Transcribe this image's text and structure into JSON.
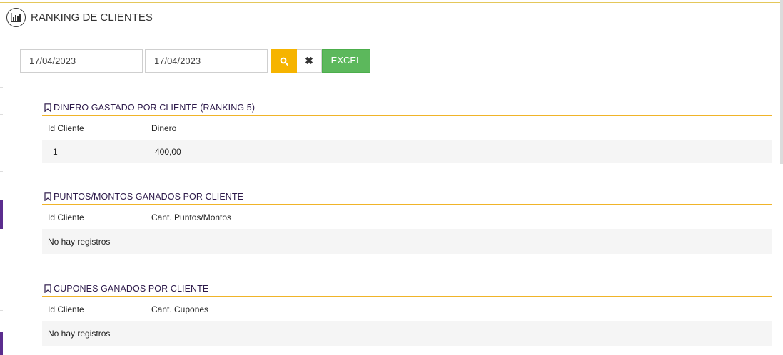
{
  "page": {
    "title": "RANKING DE CLIENTES",
    "header_icon": "bar-chart-icon"
  },
  "filters": {
    "date_from": "17/04/2023",
    "date_to": "17/04/2023",
    "search_icon": "search-icon",
    "clear_icon": "close-icon",
    "clear_label": "✖",
    "excel_label": "EXCEL"
  },
  "colors": {
    "accent_yellow": "#f6b400",
    "excel_green": "#5cb85c",
    "section_title": "#2d1a4a",
    "sidebar_accent": "#5b2d8e"
  },
  "sections": [
    {
      "title": "DINERO GASTADO POR CLIENTE (RANKING 5)",
      "icon": "bookmark-icon",
      "columns": [
        "Id Cliente",
        "Dinero"
      ],
      "rows": [
        [
          "1",
          "400,00"
        ]
      ]
    },
    {
      "title": "PUNTOS/MONTOS GANADOS POR CLIENTE",
      "icon": "bookmark-icon",
      "columns": [
        "Id Cliente",
        "Cant. Puntos/Montos"
      ],
      "empty_text": "No hay registros"
    },
    {
      "title": "CUPONES GANADOS POR CLIENTE",
      "icon": "bookmark-icon",
      "columns": [
        "Id Cliente",
        "Cant. Cupones"
      ],
      "empty_text": "No hay registros"
    }
  ]
}
